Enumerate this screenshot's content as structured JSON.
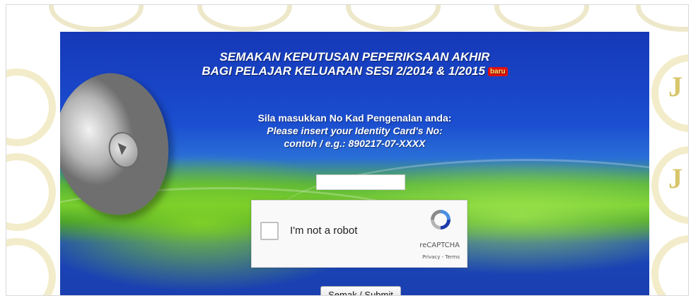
{
  "banner": {
    "title_line1": "SEMAKAN KEPUTUSAN PEPERIKSAAN AKHIR",
    "title_line2": "BAGI PELAJAR KELUARAN SESI 2/2014 & 1/2015",
    "badge": "baru"
  },
  "instructions": {
    "line1": "Sila masukkan No Kad Pengenalan anda:",
    "line2": "Please insert your Identity Card's No:",
    "line3": "contoh / e.g.: 890217-07-XXXX"
  },
  "ic_input": {
    "value": "",
    "placeholder": ""
  },
  "recaptcha": {
    "label": "I'm not a robot",
    "brand": "reCAPTCHA",
    "links": "Privacy - Terms",
    "icon": "recaptcha-logo-icon"
  },
  "submit": {
    "label": "Semak / Submit"
  },
  "watermark": {
    "letter": "J"
  },
  "colors": {
    "accent_blue": "#1b4ed0",
    "accent_green": "#74cc2c",
    "badge_red": "#e01010"
  }
}
